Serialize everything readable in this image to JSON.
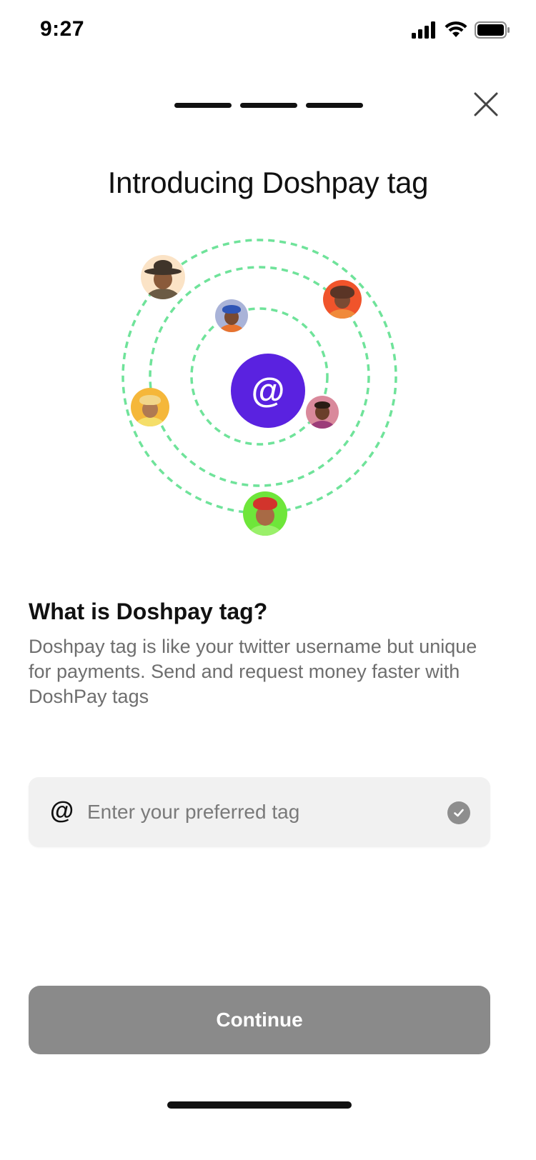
{
  "status_bar": {
    "time": "9:27"
  },
  "progress": {
    "steps": 3
  },
  "header": {
    "title": "Introducing Doshpay tag"
  },
  "illustration": {
    "center_symbol": "@",
    "ring_color": "#6fe39a",
    "center_color": "#5a22e0"
  },
  "info": {
    "heading": "What is Doshpay tag?",
    "description": "Doshpay tag is like your twitter username but unique for payments. Send and request money faster with DoshPay tags"
  },
  "tag_field": {
    "prefix": "@",
    "placeholder": "Enter your preferred tag",
    "value": ""
  },
  "actions": {
    "continue_label": "Continue"
  },
  "icons": {
    "signal": "cellular-signal-icon",
    "wifi": "wifi-icon",
    "battery": "battery-icon",
    "close": "close-icon",
    "check": "check-circle-icon"
  }
}
